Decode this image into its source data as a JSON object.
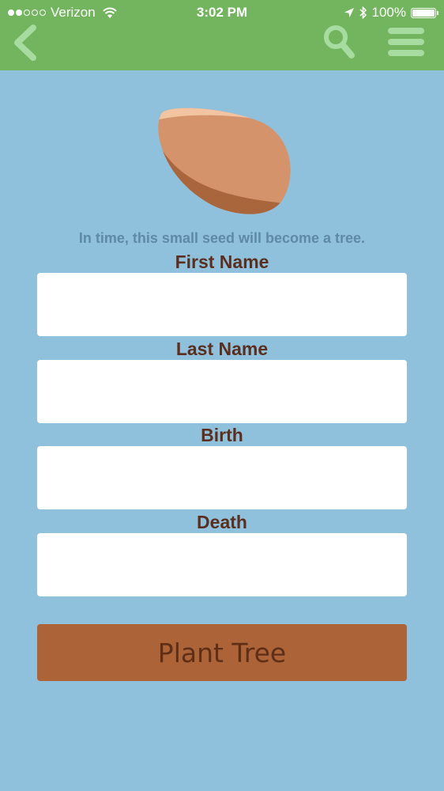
{
  "status_bar": {
    "carrier": "Verizon",
    "time": "3:02 PM",
    "battery": "100%",
    "signal_bars_filled": 2,
    "signal_bars_total": 5
  },
  "nav": {
    "back_icon": "chevron-left-icon",
    "search_icon": "search-icon",
    "menu_icon": "hamburger-menu-icon"
  },
  "hero": {
    "icon": "seed-icon",
    "caption": "In time, this small seed will become a tree."
  },
  "form": {
    "first_name_label": "First Name",
    "first_name_value": "",
    "last_name_label": "Last Name",
    "last_name_value": "",
    "birth_label": "Birth",
    "birth_value": "",
    "death_label": "Death",
    "death_value": "",
    "submit_label": "Plant Tree"
  },
  "colors": {
    "nav_bar": "#73b55e",
    "nav_icons": "#a6dca0",
    "background": "#8fc1dc",
    "label_text": "#5b2f1f",
    "caption_text": "#5e8aa6",
    "button": "#ab6337",
    "button_text": "#5e2e17",
    "seed": "#d4936a",
    "seed_shadow": "#a9653c",
    "seed_highlight": "#f2c4a2"
  }
}
